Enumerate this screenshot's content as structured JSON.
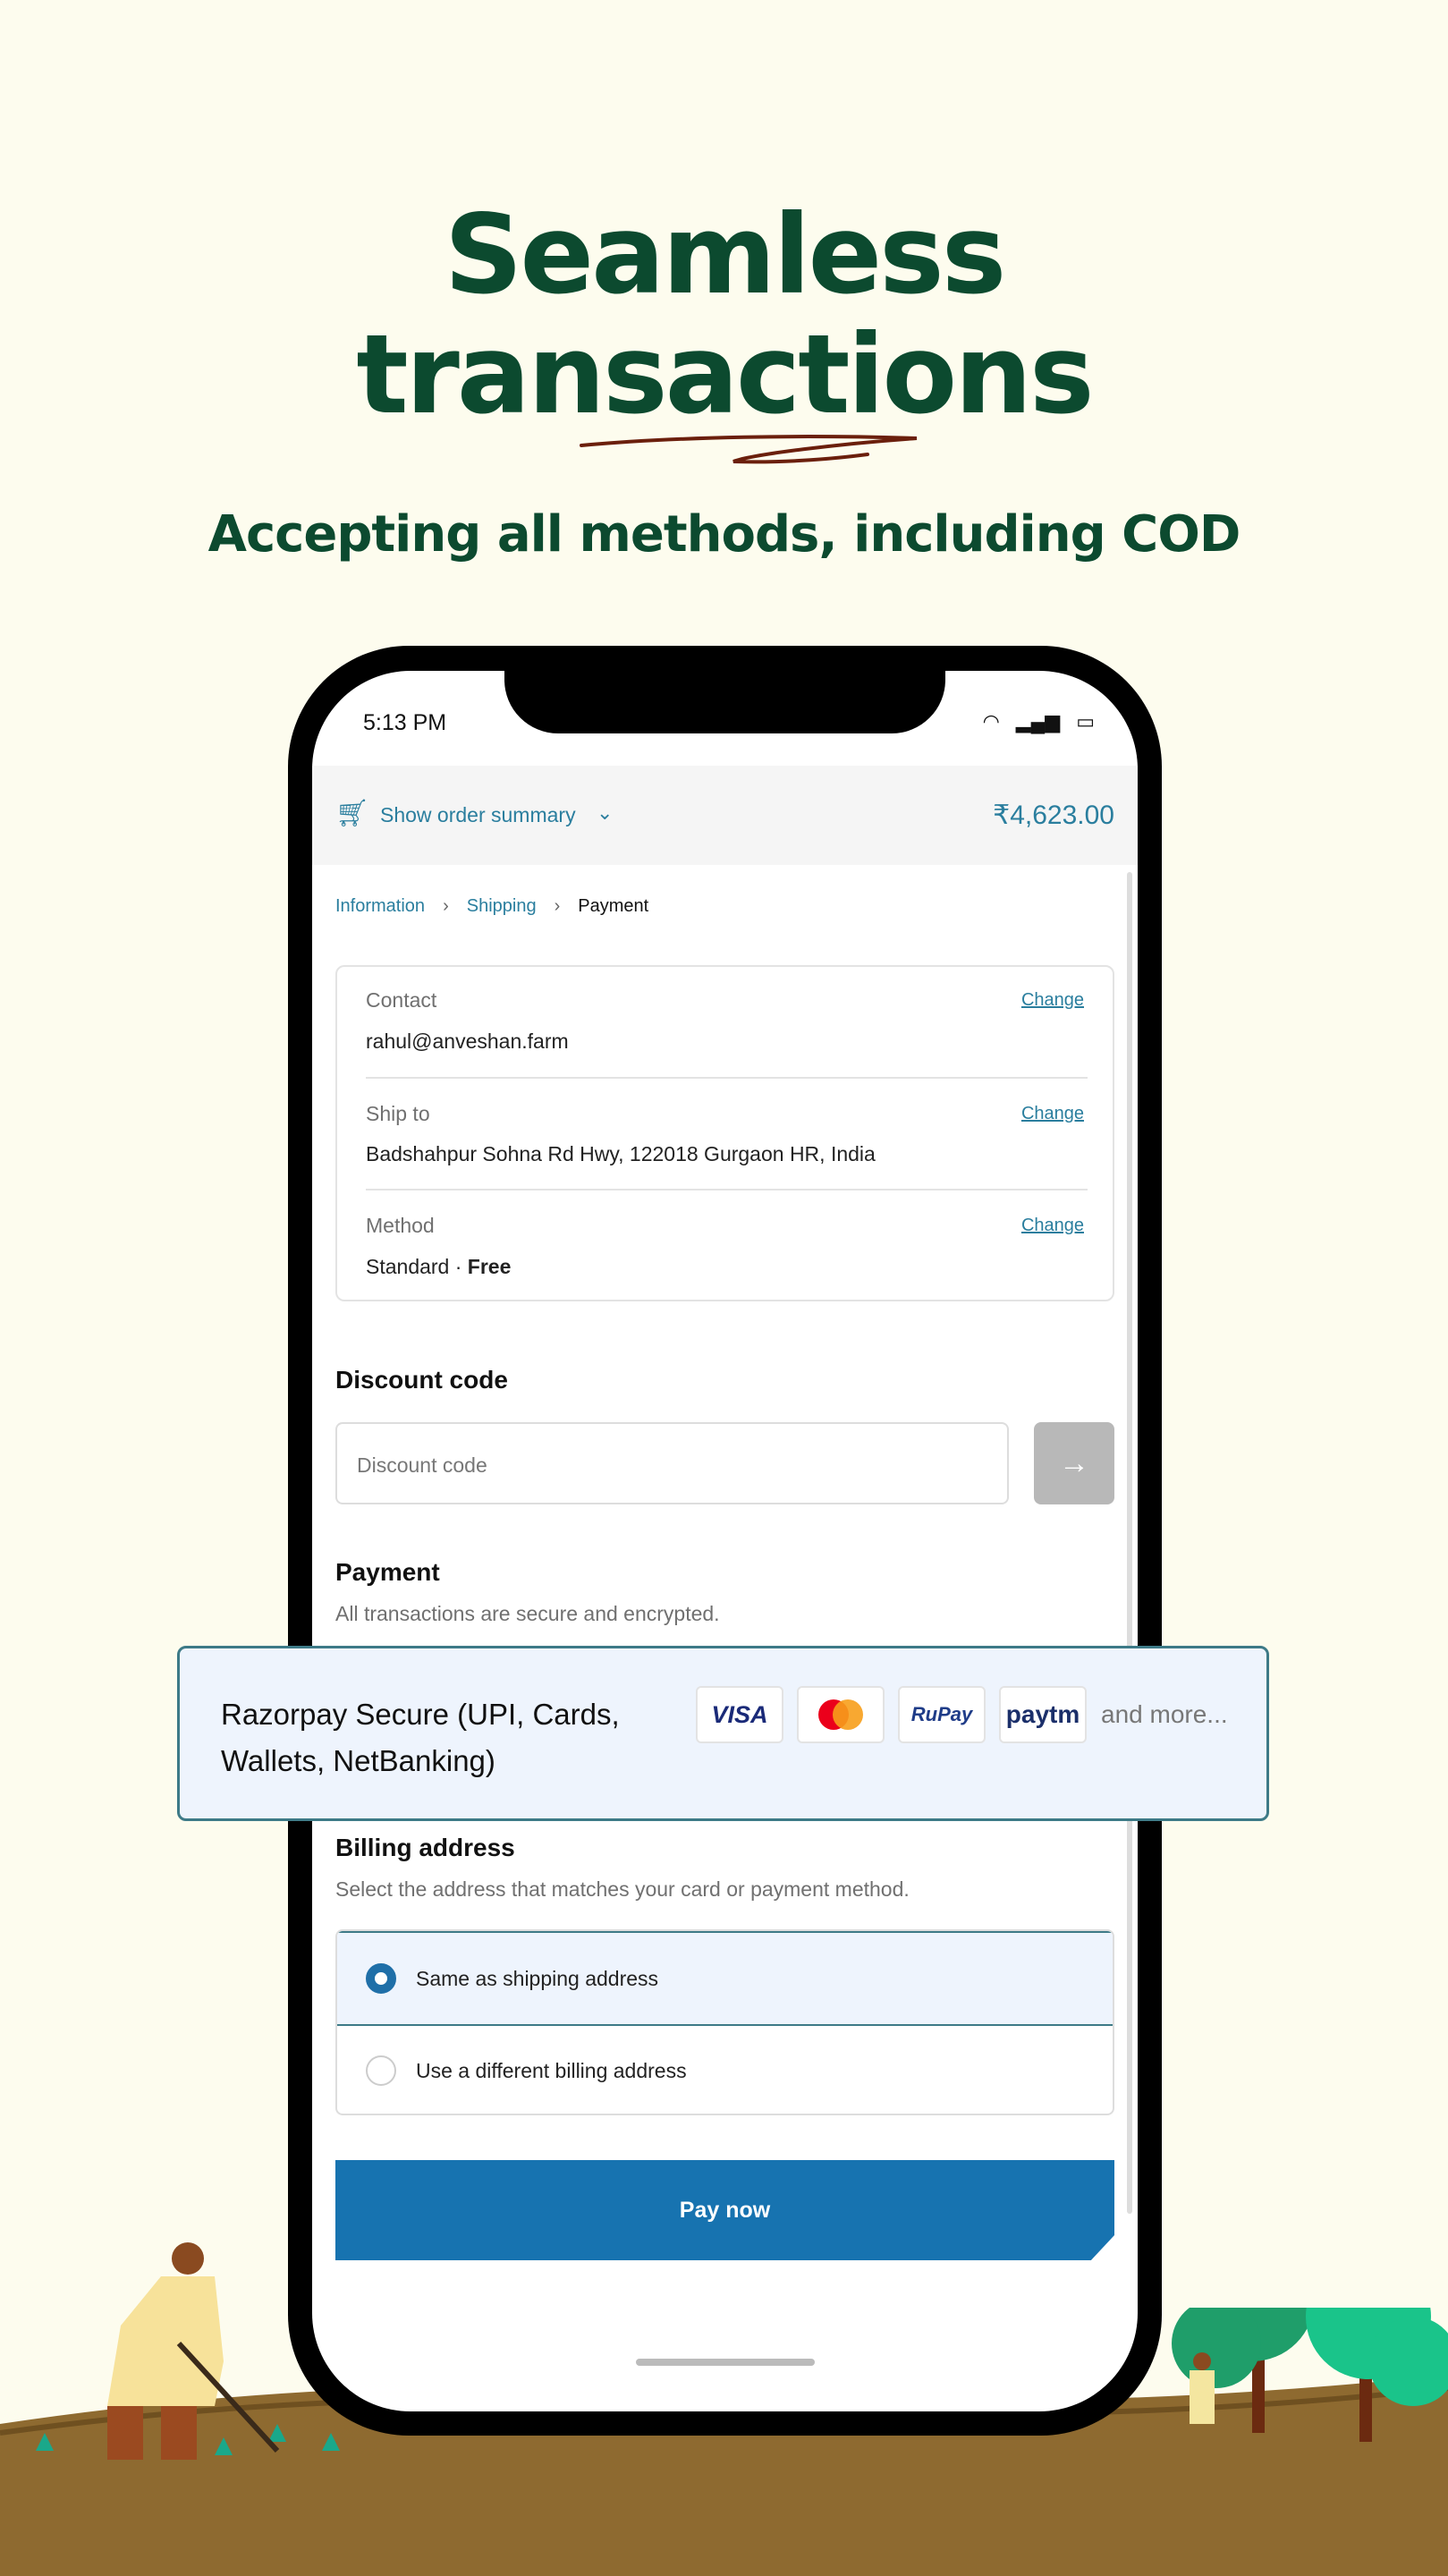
{
  "hero": {
    "title_line1": "Seamless",
    "title_line2": "transactions",
    "subtitle": "Accepting all methods, including COD"
  },
  "status_bar": {
    "time": "5:13 PM",
    "icons": [
      "wifi-icon",
      "signal-icon",
      "battery-icon"
    ]
  },
  "order_summary": {
    "label": "Show order summary",
    "total": "₹4,623.00"
  },
  "breadcrumb": [
    "Information",
    "Shipping",
    "Payment"
  ],
  "review": {
    "contact": {
      "label": "Contact",
      "value": "rahul@anveshan.farm",
      "change": "Change"
    },
    "ship_to": {
      "label": "Ship to",
      "value": "Badshahpur Sohna Rd Hwy, 122018 Gurgaon HR, India",
      "change": "Change"
    },
    "method": {
      "label": "Method",
      "value": "Standard · ",
      "value_bold": "Free",
      "change": "Change"
    }
  },
  "discount": {
    "heading": "Discount code",
    "placeholder": "Discount code"
  },
  "payment": {
    "heading": "Payment",
    "subtitle": "All transactions are secure and encrypted.",
    "razorpay": {
      "line1": "Razorpay Secure (UPI, Cards,",
      "line2": "Wallets, NetBanking)",
      "logos": [
        "VISA",
        "Mastercard",
        "RuPay",
        "paytm"
      ],
      "more": "and more..."
    }
  },
  "billing": {
    "heading": "Billing address",
    "subtitle": "Select the address that matches your card or payment method.",
    "options": [
      {
        "label": "Same as shipping address",
        "selected": true
      },
      {
        "label": "Use a different billing address",
        "selected": false
      }
    ]
  },
  "pay_button": "Pay now",
  "colors": {
    "accent": "#2a7e9e",
    "pay": "#1773b0",
    "brand_green": "#0c4a2f"
  }
}
